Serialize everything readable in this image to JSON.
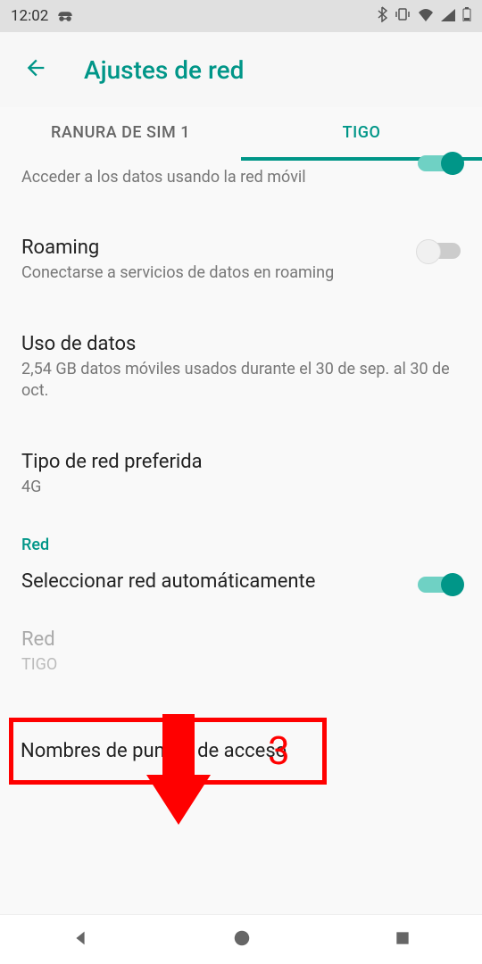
{
  "status_bar": {
    "time": "12:02"
  },
  "header": {
    "title": "Ajustes de red"
  },
  "tabs": {
    "sim1": "RANURA DE SIM 1",
    "sim2": "TIGO"
  },
  "mobile_data": {
    "subtitle": "Acceder a los datos usando la red móvil"
  },
  "roaming": {
    "title": "Roaming",
    "subtitle": "Conectarse a servicios de datos en roaming"
  },
  "data_usage": {
    "title": "Uso de datos",
    "subtitle": "2,54 GB datos móviles usados durante el 30 de sep. al 30 de oct."
  },
  "network_type": {
    "title": "Tipo de red preferida",
    "subtitle": "4G"
  },
  "section": {
    "red": "Red"
  },
  "auto_network": {
    "title": "Seleccionar red automáticamente"
  },
  "network": {
    "title": "Red",
    "subtitle": "TIGO"
  },
  "apn": {
    "title": "Nombres de puntos de acceso"
  },
  "annotation": {
    "number": "3"
  }
}
